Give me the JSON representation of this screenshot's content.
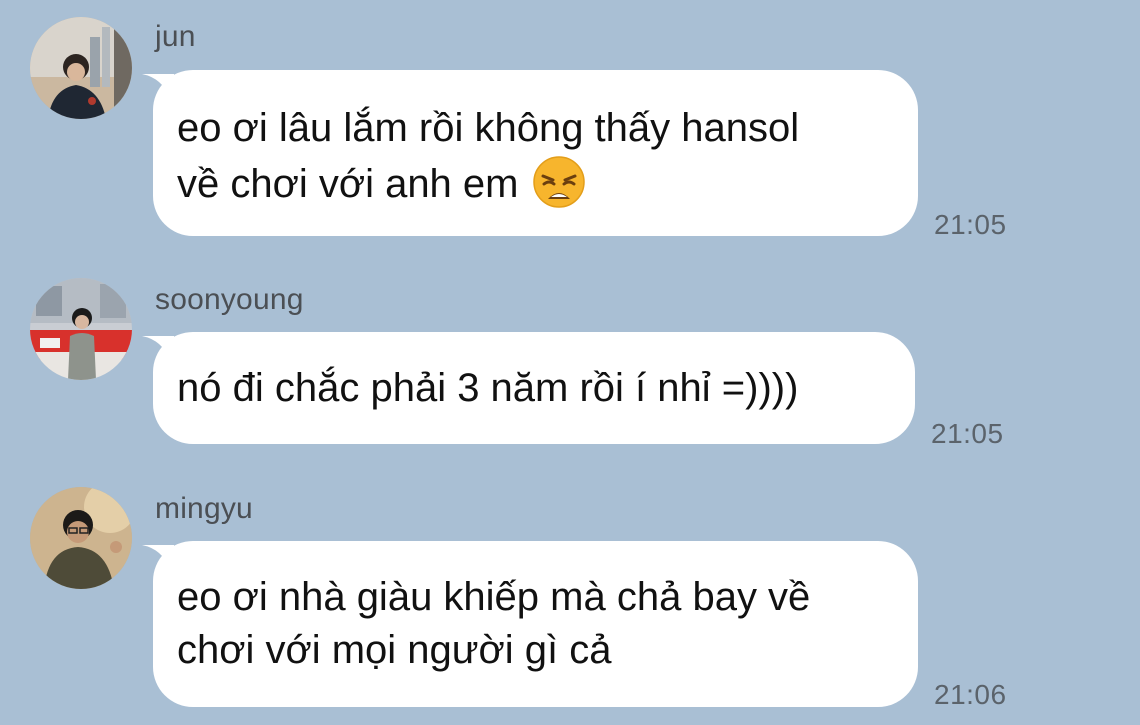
{
  "messages": [
    {
      "sender": "jun",
      "lines": [
        "eo ơi lâu lắm rồi không thấy hansol",
        "về chơi với anh em"
      ],
      "emoji": "weary-face",
      "time": "21:05"
    },
    {
      "sender": "soonyoung",
      "lines": [
        "nó đi chắc phải 3 năm rồi í nhỉ =))))"
      ],
      "time": "21:05"
    },
    {
      "sender": "mingyu",
      "lines": [
        "eo ơi nhà giàu khiếp mà chả bay về",
        "chơi với mọi người gì cả"
      ],
      "time": "21:06"
    }
  ],
  "colors": {
    "background": "#a9bfd4",
    "bubble": "#ffffff",
    "sender_text": "#4b4f54",
    "time_text": "#5b636b"
  }
}
